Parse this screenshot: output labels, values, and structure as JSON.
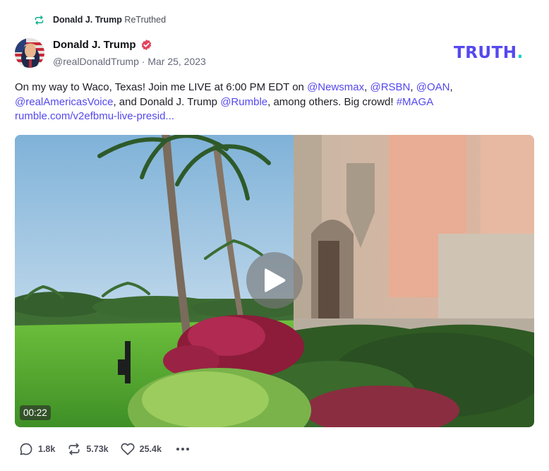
{
  "retruth": {
    "icon": "retruth-icon",
    "user": "Donald J. Trump",
    "label": "ReTruthed"
  },
  "author": {
    "display_name": "Donald J. Trump",
    "verified_icon": "verified-badge-icon",
    "handle": "@realDonaldTrump",
    "separator": "·",
    "date": "Mar 25, 2023"
  },
  "brand": {
    "logo_text": "TRUTH",
    "logo_dot": ".",
    "primary_color": "#5448ee",
    "accent_color": "#0fd0c5"
  },
  "post": {
    "t1": "On my way to Waco, Texas! Join me LIVE at 6:00 PM EDT on ",
    "m1": "@Newsmax",
    "t2": ", ",
    "m2": "@RSBN",
    "t3": ", ",
    "m3": "@OAN",
    "t4": ", ",
    "m4": "@realAmericasVoice",
    "t5": ", and Donald J. Trump ",
    "m5": "@Rumble",
    "t6": ", among others. Big crowd! ",
    "hashtag": "#MAGA",
    "url": "rumble.com/v2efbmu-live-presid..."
  },
  "video": {
    "duration": "00:22",
    "play_icon": "play-icon"
  },
  "actions": {
    "replies": "1.8k",
    "retruths": "5.73k",
    "likes": "25.4k",
    "reply_icon": "comment-icon",
    "retruth_icon": "retruth-icon",
    "like_icon": "heart-icon",
    "more_icon": "more-options-icon"
  }
}
